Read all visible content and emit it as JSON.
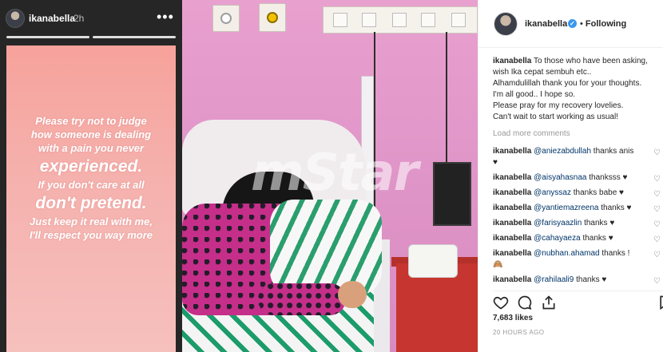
{
  "story": {
    "username": "ikanabella",
    "time": "2h",
    "more": "•••",
    "lines": [
      {
        "text": "Please try not to judge",
        "size": "normal"
      },
      {
        "text": "how someone is dealing",
        "size": "normal"
      },
      {
        "text": "with a pain you never",
        "size": "normal"
      },
      {
        "text": "experienced.",
        "size": "big"
      },
      {
        "text": "If you don't care at all",
        "size": "normal"
      },
      {
        "text": "don't pretend.",
        "size": "big"
      },
      {
        "text": "Just keep it real with me,",
        "size": "normal"
      },
      {
        "text": "I'll respect you way more",
        "size": "normal"
      }
    ],
    "colors": {
      "card_top": "#f7a29b",
      "card_bottom": "#f6c0bd",
      "background": "#262626"
    }
  },
  "photo": {
    "watermark": "mStar",
    "colors": {
      "wall": "#de93c6",
      "cabinet": "#c6352f",
      "shirt": "#c52f8a",
      "stripes": "#1c9c6a"
    }
  },
  "post": {
    "username": "ikanabella",
    "verified_icon": "verified-badge-icon",
    "separator": "•",
    "follow_status": "Following",
    "caption_user": "ikanabella",
    "caption_lines": [
      "To those who have been asking,",
      "wish Ika cepat sembuh etc..",
      "Alhamdulillah thank you for your thoughts.",
      "I'm all good.. I hope so.",
      "Please pray for my recovery lovelies.",
      "Can't wait to start working as usual!"
    ],
    "load_more": "Load more comments",
    "comments": [
      {
        "user": "ikanabella",
        "mention": "@aniezabdullah",
        "text": " thanks anis",
        "extra": "♥"
      },
      {
        "user": "ikanabella",
        "mention": "@aisyahasnaa",
        "text": " thanksss ♥",
        "extra": ""
      },
      {
        "user": "ikanabella",
        "mention": "@anyssaz",
        "text": " thanks babe ♥",
        "extra": ""
      },
      {
        "user": "ikanabella",
        "mention": "@yantiemazreena",
        "text": " thanks ♥",
        "extra": ""
      },
      {
        "user": "ikanabella",
        "mention": "@farisyaazlin",
        "text": " thanks ♥",
        "extra": ""
      },
      {
        "user": "ikanabella",
        "mention": "@cahayaeza",
        "text": " thanks ♥",
        "extra": ""
      },
      {
        "user": "ikanabella",
        "mention": "@nubhan.ahamad",
        "text": " thanks !",
        "extra": "🙈"
      },
      {
        "user": "ikanabella",
        "mention": "@rahilaali9",
        "text": " thanks ♥",
        "extra": ""
      }
    ],
    "comment_like_icon": "♡",
    "likes": "7,683 likes",
    "time_ago": "20 HOURS AGO",
    "colors": {
      "mention": "#003569",
      "muted": "#999999",
      "verified": "#3897f0"
    }
  }
}
